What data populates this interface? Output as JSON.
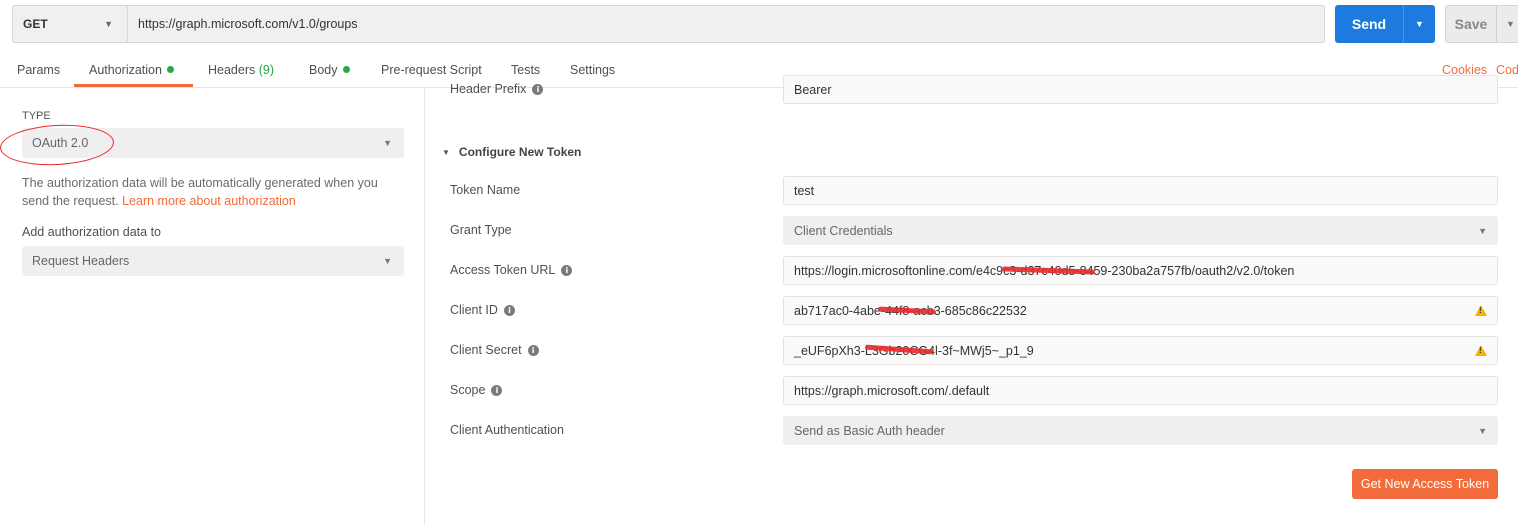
{
  "request": {
    "method": "GET",
    "url": "https://graph.microsoft.com/v1.0/groups",
    "send_label": "Send",
    "save_label": "Save"
  },
  "tabs": {
    "params": "Params",
    "authorization": "Authorization",
    "headers": "Headers",
    "headers_count": "(9)",
    "body": "Body",
    "prerequest": "Pre-request Script",
    "tests": "Tests",
    "settings": "Settings",
    "cookies": "Cookies",
    "code": "Cod"
  },
  "auth": {
    "type_label": "TYPE",
    "type_value": "OAuth 2.0",
    "hint_text": "The authorization data will be automatically generated when you send the request.",
    "hint_link": "Learn more about authorization",
    "add_label": "Add authorization data to",
    "add_value": "Request Headers"
  },
  "config": {
    "header_prefix_label": "Header Prefix",
    "header_prefix_value": "Bearer",
    "section_title": "Configure New Token",
    "token_name_label": "Token Name",
    "token_name_value": "test",
    "grant_type_label": "Grant Type",
    "grant_type_value": "Client Credentials",
    "access_token_url_label": "Access Token URL",
    "access_token_url_value": "https://login.microsoftonline.com/e4c9c3-d37c40d5-8459-230ba2a757fb/oauth2/v2.0/token",
    "client_id_label": "Client ID",
    "client_id_value": "ab717ac0-4abe-44f8-acb3-685c86c22532",
    "client_secret_label": "Client Secret",
    "client_secret_value": "_eUF6pXh3-L3Gb20CG4l-3f~MWj5~_p1_9",
    "scope_label": "Scope",
    "scope_value": "https://graph.microsoft.com/.default",
    "client_auth_label": "Client Authentication",
    "client_auth_value": "Send as Basic Auth header",
    "get_token_label": "Get New Access Token"
  },
  "colors": {
    "accent": "#f26b3a",
    "primary": "#1d7be0",
    "status_green": "#26a94a",
    "warning": "#f5b400",
    "annotation_red": "#e8282b"
  }
}
